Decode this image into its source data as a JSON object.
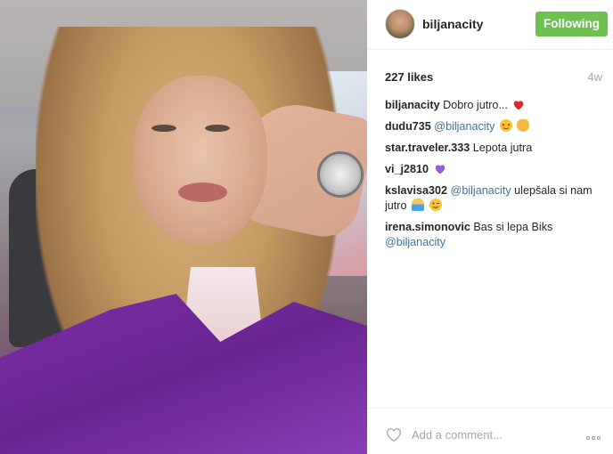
{
  "post": {
    "username": "biljanacity",
    "follow_label": "Following",
    "likes": "227 likes",
    "time": "4w",
    "comment_placeholder": "Add a comment...",
    "photo_icon": "photo-of-woman-in-car"
  },
  "comments": [
    {
      "user": "biljanacity",
      "text": "Dobro jutro...",
      "emoji": [
        "red-heart"
      ]
    },
    {
      "user": "dudu735",
      "mention": "@biljanacity",
      "emoji": [
        "heart-eyes-face",
        "ok-hand"
      ]
    },
    {
      "user": "star.traveler.333",
      "text": "Lepota jutra"
    },
    {
      "user": "vi_j2810",
      "emoji": [
        "purple-heart"
      ]
    },
    {
      "user": "kslavisa302",
      "mention": "@biljanacity",
      "text": "ulepšala si nam jutro",
      "emoji": [
        "bowing-person",
        "winking-face"
      ]
    },
    {
      "user": "irena.simonovic",
      "text": "Bas si lepa Biks",
      "mention": "@biljanacity"
    }
  ],
  "colors": {
    "follow_bg": "#70c050",
    "mention": "#3f729b",
    "muted": "#a5a7aa"
  }
}
